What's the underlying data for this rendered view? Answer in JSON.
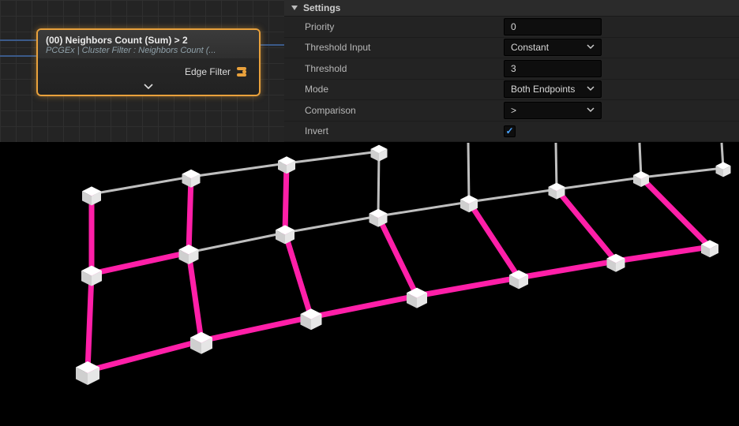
{
  "graph": {
    "node": {
      "title": "(00) Neighbors Count (Sum) > 2",
      "subtitle": "PCGEx | Cluster Filter : Neighbors Count (...",
      "pin_edge_filter": "Edge Filter"
    }
  },
  "settings": {
    "section_title": "Settings",
    "rows": {
      "priority": {
        "label": "Priority",
        "value": "0"
      },
      "threshold_input": {
        "label": "Threshold Input",
        "value": "Constant"
      },
      "threshold": {
        "label": "Threshold",
        "value": "3"
      },
      "mode": {
        "label": "Mode",
        "value": "Both Endpoints"
      },
      "comparison": {
        "label": "Comparison",
        "value": ">"
      },
      "invert": {
        "label": "Invert",
        "checked": true
      }
    }
  },
  "viewport": {
    "colors": {
      "edge_highlight": "#ff1fa8",
      "edge_normal": "#bfbfbf",
      "cube_face": "#f0f0f0",
      "cube_top": "#ffffff",
      "cube_side": "#cfcfcf"
    }
  }
}
